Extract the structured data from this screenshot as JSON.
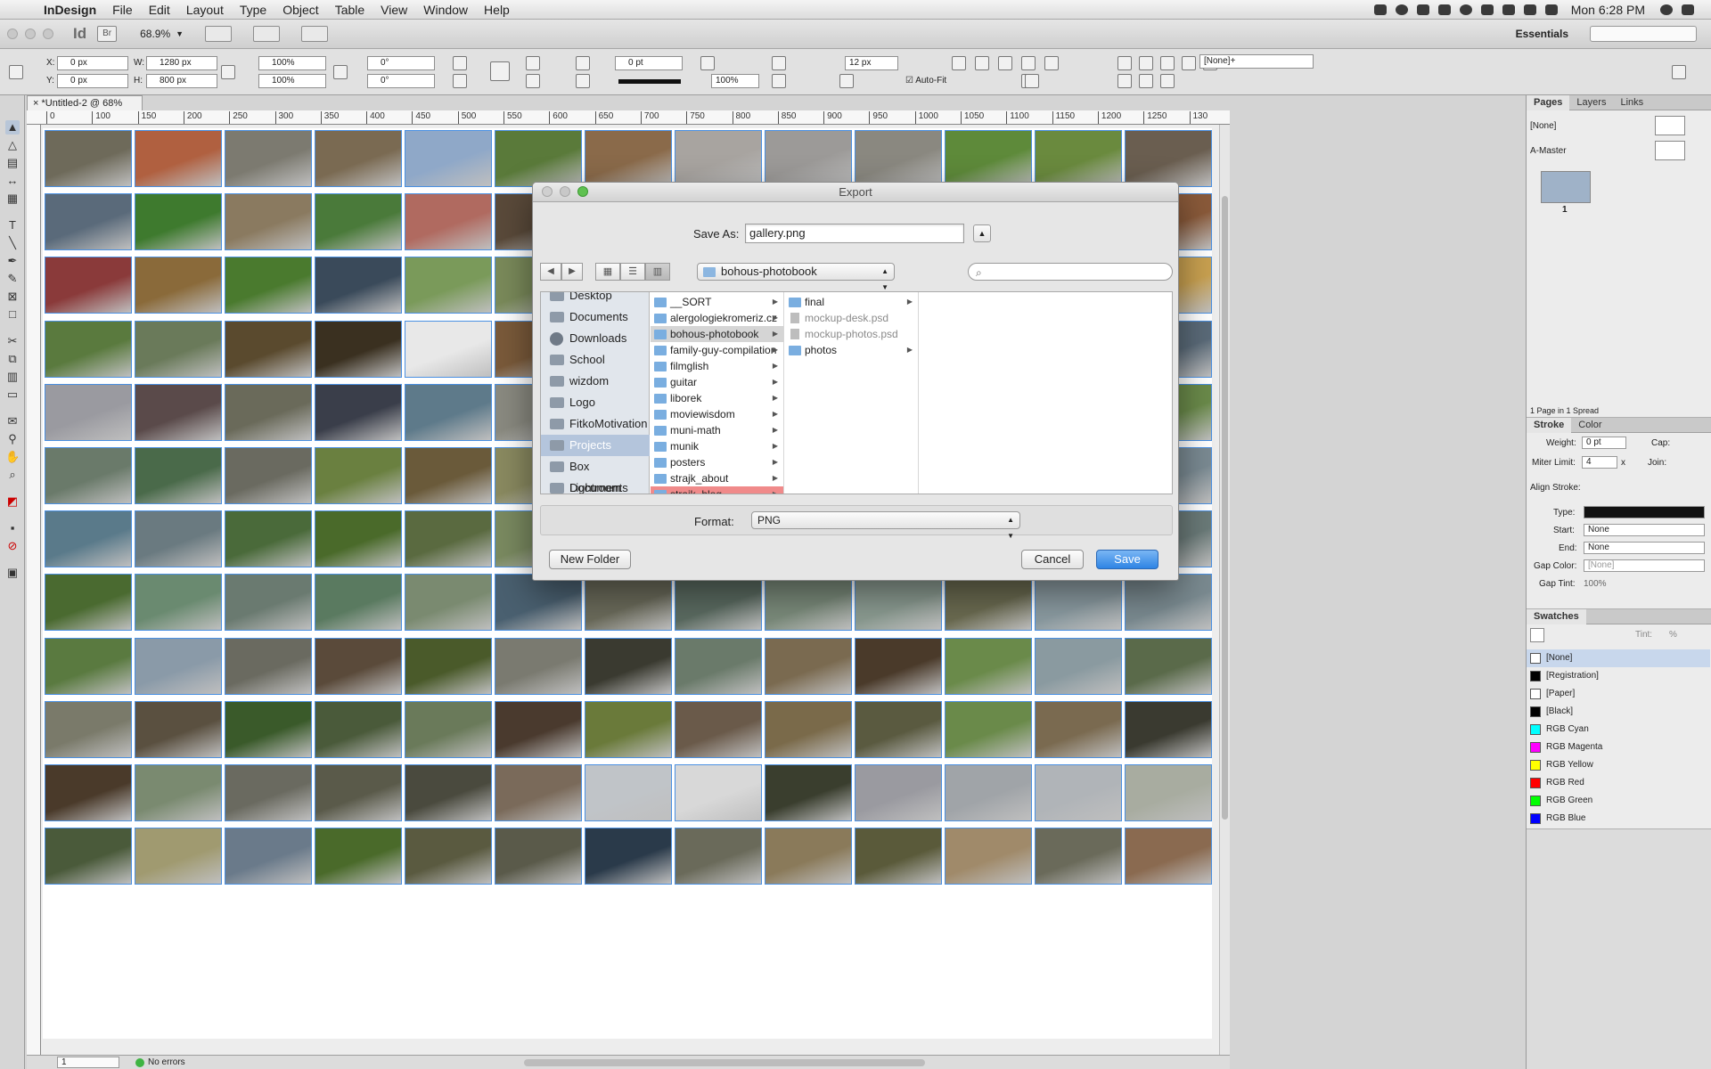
{
  "menubar": {
    "app_name": "InDesign",
    "items": [
      "File",
      "Edit",
      "Layout",
      "Type",
      "Object",
      "Table",
      "View",
      "Window",
      "Help"
    ],
    "clock": "Mon 6:28 PM"
  },
  "appbar": {
    "logo": "Id",
    "bridge": "Br",
    "zoom": "68.9%",
    "workspace": "Essentials"
  },
  "control": {
    "x_label": "X:",
    "x_value": "0 px",
    "y_label": "Y:",
    "y_value": "0 px",
    "w_label": "W:",
    "w_value": "1280 px",
    "h_label": "H:",
    "h_value": "800 px",
    "scale_x": "100%",
    "scale_y": "100%",
    "rotate": "0°",
    "shear": "0°",
    "stroke_weight": "0 pt",
    "opacity": "100%",
    "gutter": "12 px",
    "autofit_label": "Auto-Fit",
    "object_style": "[None]+"
  },
  "document": {
    "tab_title": "*Untitled-2 @ 68%",
    "ruler_ticks": [
      "0",
      "100",
      "150",
      "200",
      "250",
      "300",
      "350",
      "400",
      "450",
      "500",
      "550",
      "600",
      "650",
      "700",
      "750",
      "800",
      "850",
      "900",
      "950",
      "1000",
      "1050",
      "1100",
      "1150",
      "1200",
      "1250",
      "130"
    ],
    "status_page": "1",
    "status_errors": "No errors"
  },
  "photos": {
    "colors": [
      "#6e6a5a",
      "#b06040",
      "#7c7a70",
      "#7a6a52",
      "#8fa8c8",
      "#5a7a3a",
      "#8a6a4a",
      "#a8a4a0",
      "#9c9a98",
      "#8a8880",
      "#5e8a3a",
      "#6a8a3e",
      "#6a5e50",
      "#5a6a7a",
      "#3e7a2e",
      "#8a7a60",
      "#4a7a3a",
      "#b06a60",
      "#5a4a3a",
      "#9a8a7a",
      "#4a3a2e",
      "#6a8a9a",
      "#3e6a2a",
      "#4a6a2a",
      "#7a7a6a",
      "#8a5a3a",
      "#8a3a3a",
      "#8a6a3a",
      "#4a7a2e",
      "#3a4a5a",
      "#7a9a5a",
      "#7a8a5a",
      "#6a3a3a",
      "#5a3e2a",
      "#7a8aa0",
      "#8a5a30",
      "#6a7a82",
      "#3a2a1e",
      "#c8a050",
      "#5a7a3e",
      "#6a7a5a",
      "#5a4a2e",
      "#3a3020",
      "#e8e8e8",
      "#7a5a3a",
      "#8a6a2a",
      "#7a4a2a",
      "#7a6a3a",
      "#7a7a50",
      "#c8b040",
      "#8a9a8a",
      "#5a6a78",
      "#9a9aa0",
      "#5a4a4a",
      "#6a6a5a",
      "#3a3e4a",
      "#5e7a8a",
      "#8a8a80",
      "#8a9070",
      "#7a7a6a",
      "#6a7a82",
      "#a0a6a8",
      "#7a7a50",
      "#7a9a6a",
      "#6a8a4a",
      "#6a7a6a",
      "#4a6a4a",
      "#6a6a60",
      "#6a8040",
      "#6a5a3a",
      "#8a8a60",
      "#6a8a3a",
      "#3a5a2a",
      "#5e7a6a",
      "#6a8ab0",
      "#6a6a5a",
      "#4a5a3a",
      "#7a8a92",
      "#5a7a8a",
      "#6a7a80",
      "#4a6a3a",
      "#4a6a2a",
      "#5a6a40",
      "#7a8a60",
      "#8a8a7a",
      "#6a8a40",
      "#6a6a60",
      "#7a8a90",
      "#6a8a9a",
      "#6a8aa0",
      "#6a7a78",
      "#4a6a30",
      "#6a8a70",
      "#6a7a70",
      "#5a7a60",
      "#7a8a70",
      "#4a6070",
      "#6a6a5a",
      "#5a6a60",
      "#7a8a7a",
      "#8a9a90",
      "#6a6a50",
      "#8a9aa0",
      "#7a8a90",
      "#5a7a40",
      "#8a9aa8",
      "#6a6a60",
      "#5a4a3a",
      "#4a5a2a",
      "#7a7a70",
      "#3a3a30",
      "#6a7a6a",
      "#7a6a50",
      "#4a3a2a",
      "#6a8a4a",
      "#8a9aa0",
      "#5a6a4a",
      "#7a7a6a",
      "#5a5040",
      "#3a5a2a",
      "#4a5a3a",
      "#6a7a5a",
      "#4a3a2e",
      "#6a7a3a",
      "#6a5a4a",
      "#7a6a4a",
      "#5a5a40",
      "#6a8a4a",
      "#7a6a50",
      "#3a3a30",
      "#4a3a2a",
      "#7a8a70",
      "#6a6a60",
      "#5a5a4a",
      "#4a4a3e",
      "#7a6a5a",
      "#c0c4c8",
      "#d8d8d8",
      "#3a3e2e",
      "#9a9aa0",
      "#a0a4a8",
      "#b0b4b8",
      "#a8aca0",
      "#4a5a3a",
      "#a09a70",
      "#6a7a8a",
      "#4a6a2a",
      "#5a5a40",
      "#5a5a4a",
      "#2a3a4a",
      "#6a6a5a",
      "#8a7a5a",
      "#5a5a3a",
      "#a08a6a",
      "#6a6a5a",
      "#8a6a50",
      "#5a4a3a",
      "#9a5a3a",
      "#7a6a5a",
      "#8a8aa0",
      "#8a9aa0",
      "#6a6a60",
      "#a07a4a",
      "#6a5a4a"
    ]
  },
  "dialog": {
    "title": "Export",
    "save_as_label": "Save As:",
    "filename": "gallery.png",
    "location": "bohous-photobook",
    "sidebar": [
      "Desktop",
      "Documents",
      "Downloads",
      "School",
      "wizdom",
      "Logo",
      "FitkoMotivation",
      "Projects",
      "Box Documents",
      "Lightroom"
    ],
    "column1": [
      "__SORT",
      "alergologiekromeriz.cz",
      "bohous-photobook",
      "family-guy-compilation",
      "filmglish",
      "guitar",
      "liborek",
      "moviewisdom",
      "muni-math",
      "munik",
      "posters",
      "strajk_about",
      "strajk_blog"
    ],
    "column2": [
      "final",
      "mockup-desk.psd",
      "mockup-photos.psd",
      "photos"
    ],
    "format_label": "Format:",
    "format_value": "PNG",
    "new_folder": "New Folder",
    "cancel": "Cancel",
    "save": "Save"
  },
  "panels": {
    "pages_tabs": [
      "Pages",
      "Layers",
      "Links"
    ],
    "none_label": "[None]",
    "master_label": "A-Master",
    "page_number": "1",
    "spread_info": "1 Page in 1 Spread",
    "stroke_tabs": [
      "Stroke",
      "Color"
    ],
    "weight_label": "Weight:",
    "weight_value": "0 pt",
    "cap_label": "Cap:",
    "miter_label": "Miter Limit:",
    "miter_value": "4",
    "miter_x": "x",
    "join_label": "Join:",
    "align_label": "Align Stroke:",
    "type_label": "Type:",
    "start_label": "Start:",
    "start_value": "None",
    "end_label": "End:",
    "end_value": "None",
    "gap_color_label": "Gap Color:",
    "gap_color_value": "[None]",
    "gap_tint_label": "Gap Tint:",
    "gap_tint_value": "100%",
    "swatches_tab": "Swatches",
    "tint_label": "Tint:",
    "tint_pct": "%",
    "swatches": [
      {
        "name": "[None]",
        "color": "#ffffff"
      },
      {
        "name": "[Registration]",
        "color": "#000000"
      },
      {
        "name": "[Paper]",
        "color": "#ffffff"
      },
      {
        "name": "[Black]",
        "color": "#000000"
      },
      {
        "name": "RGB Cyan",
        "color": "#00ffff"
      },
      {
        "name": "RGB Magenta",
        "color": "#ff00ff"
      },
      {
        "name": "RGB Yellow",
        "color": "#ffff00"
      },
      {
        "name": "RGB Red",
        "color": "#ff0000"
      },
      {
        "name": "RGB Green",
        "color": "#00ff00"
      },
      {
        "name": "RGB Blue",
        "color": "#0000ff"
      }
    ]
  }
}
